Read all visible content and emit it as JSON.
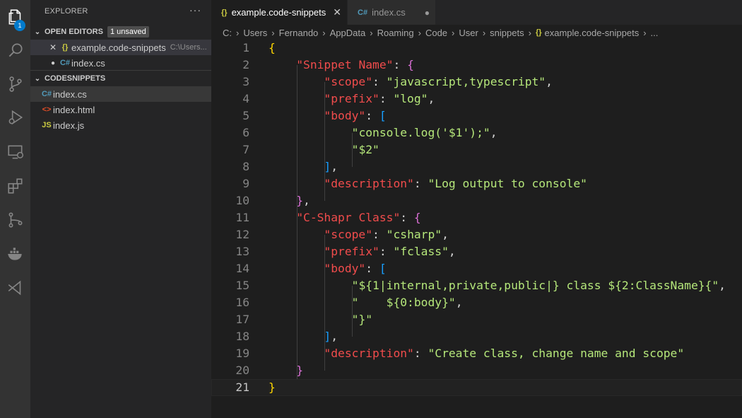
{
  "activity_bar": {
    "items": [
      {
        "icon": "files-icon",
        "badge": "1"
      },
      {
        "icon": "search-icon"
      },
      {
        "icon": "source-control-icon"
      },
      {
        "icon": "run-debug-icon"
      },
      {
        "icon": "remote-explorer-icon"
      },
      {
        "icon": "extensions-icon"
      },
      {
        "icon": "git-graph-icon"
      },
      {
        "icon": "docker-icon"
      },
      {
        "icon": "visual-studio-icon"
      }
    ]
  },
  "sidebar": {
    "title": "EXPLORER",
    "more": "···",
    "open_editors": {
      "label": "OPEN EDITORS",
      "badge": "1 unsaved",
      "items": [
        {
          "lead": "✕",
          "icon": "{}",
          "name": "example.code-snippets",
          "path": "C:\\Users..."
        },
        {
          "lead": "●",
          "icon": "C#",
          "name": "index.cs"
        }
      ]
    },
    "folder": {
      "label": "CODESNIPPETS",
      "items": [
        {
          "icon": "C#",
          "name": "index.cs"
        },
        {
          "icon": "<>",
          "name": "index.html"
        },
        {
          "icon": "JS",
          "name": "index.js"
        }
      ]
    }
  },
  "tabs": [
    {
      "icon": "{}",
      "label": "example.code-snippets",
      "close": "✕"
    },
    {
      "icon": "C#",
      "label": "index.cs",
      "close": "●"
    }
  ],
  "breadcrumb": [
    "C:",
    "Users",
    "Fernando",
    "AppData",
    "Roaming",
    "Code",
    "User",
    "snippets",
    "example.code-snippets",
    "..."
  ],
  "colors": {
    "key": "#f14c4c",
    "string": "#b5e77a",
    "bracket_gold": "#ffd700",
    "bracket_purple": "#da70d6",
    "bracket_blue": "#179fff"
  },
  "code": {
    "current_line": 21,
    "lines": [
      {
        "n": "1",
        "t": "{"
      },
      {
        "n": "2",
        "t": "    \"Snippet Name\": {"
      },
      {
        "n": "3",
        "t": "        \"scope\": \"javascript,typescript\","
      },
      {
        "n": "4",
        "t": "        \"prefix\": \"log\","
      },
      {
        "n": "5",
        "t": "        \"body\": ["
      },
      {
        "n": "6",
        "t": "            \"console.log('$1');\","
      },
      {
        "n": "7",
        "t": "            \"$2\""
      },
      {
        "n": "8",
        "t": "        ],"
      },
      {
        "n": "9",
        "t": "        \"description\": \"Log output to console\""
      },
      {
        "n": "10",
        "t": "    },"
      },
      {
        "n": "11",
        "t": "    \"C-Shapr Class\": {"
      },
      {
        "n": "12",
        "t": "        \"scope\": \"csharp\","
      },
      {
        "n": "13",
        "t": "        \"prefix\": \"fclass\","
      },
      {
        "n": "14",
        "t": "        \"body\": ["
      },
      {
        "n": "15",
        "t": "            \"${1|internal,private,public|} class ${2:ClassName}{\","
      },
      {
        "n": "16",
        "t": "            \"    ${0:body}\","
      },
      {
        "n": "17",
        "t": "            \"}\""
      },
      {
        "n": "18",
        "t": "        ],"
      },
      {
        "n": "19",
        "t": "        \"description\": \"Create class, change name and scope\""
      },
      {
        "n": "20",
        "t": "    }"
      },
      {
        "n": "21",
        "t": "}"
      }
    ]
  }
}
